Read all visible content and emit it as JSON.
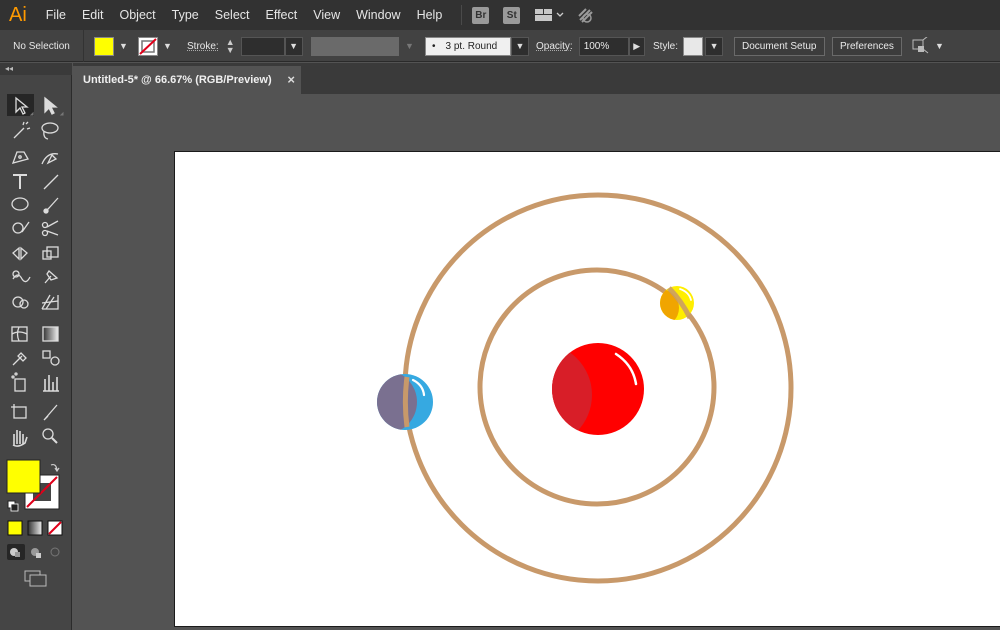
{
  "app": {
    "logo": "Ai"
  },
  "menu": {
    "items": [
      "File",
      "Edit",
      "Object",
      "Type",
      "Select",
      "Effect",
      "View",
      "Window",
      "Help"
    ],
    "bridge_badge": "Br",
    "stock_badge": "St"
  },
  "control_bar": {
    "selection_status": "No Selection",
    "fill_color": "#ffff00",
    "stroke_label": "Stroke:",
    "brush_value": "3 pt. Round",
    "opacity_label": "Opacity:",
    "opacity_value": "100%",
    "style_label": "Style:",
    "document_setup_label": "Document Setup",
    "preferences_label": "Preferences"
  },
  "document": {
    "tab_title": "Untitled-5* @ 66.67% (RGB/Preview)",
    "close_glyph": "×"
  },
  "toolbar": {
    "collapse_glyph": "◂◂",
    "fill_color": "#ffff00",
    "stroke_color": "none"
  },
  "artwork": {
    "orbit_color": "#c8996a",
    "sun": {
      "color": "#ff0000",
      "shade": "#d81e28"
    },
    "inner_planet": {
      "color": "#ffee00",
      "shade": "#f0a500"
    },
    "outer_planet": {
      "color": "#36a9e1",
      "shade": "#7a7090"
    }
  }
}
